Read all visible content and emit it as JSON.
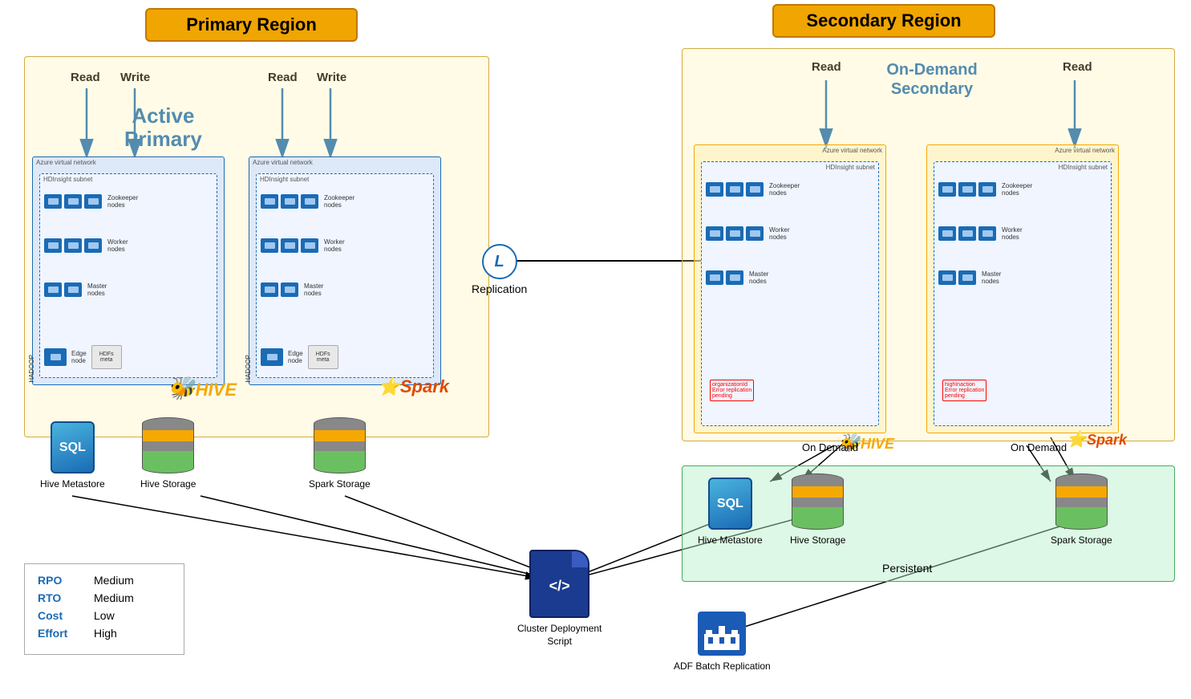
{
  "primaryRegion": {
    "label": "Primary Region",
    "activePrimary": "Active\nPrimary",
    "activePrimaryLine1": "Active",
    "activePrimaryLine2": "Primary"
  },
  "secondaryRegion": {
    "label": "Secondary Region",
    "onDemandLine1": "On-Demand",
    "onDemandLine2": "Secondary"
  },
  "labels": {
    "read1": "Read",
    "write1": "Write",
    "read2": "Read",
    "write2": "Write",
    "read3": "Read",
    "read4": "Read",
    "replication": "Replication",
    "replicationIcon": "L",
    "hiveMetastore": "Hive Metastore",
    "hiveStorage": "Hive Storage",
    "sparkStorage": "Spark Storage",
    "hiveMetastore2": "Hive Metastore",
    "hiveStorage2": "Hive Storage",
    "sparkStorage2": "Spark Storage",
    "onDemand1": "On Demand",
    "onDemand2": "On Demand",
    "persistent": "Persistent",
    "clusterDeployScript": "Cluster Deployment\nScript",
    "clusterDeployLine1": "Cluster Deployment",
    "clusterDeployLine2": "Script",
    "adfBatchReplication": "ADF Batch Replication",
    "scriptSymbol": "</>",
    "azureVnet1": "Azure virtual network",
    "azureVnet2": "Azure virtual network",
    "hdinsightSubnet1": "HDInsight subnet",
    "hdinsightSubnet2": "HDInsight subnet",
    "zookeeperNodes1": "Zookeeper\nnodes",
    "workerNodes1": "Worker\nnodes",
    "masterNodes1": "Master\nnodes",
    "zookeeperNodes2": "Zookeeper\nnodes",
    "workerNodes2": "Worker\nnodes",
    "masterNodes2": "Master\nnodes",
    "edgeNode1": "Edge\nnode",
    "edgeNode2": "Edge\nnode",
    "hdfsMetagen": "HDFs\nmeta gen",
    "hive": "HIVE",
    "spark": "Spark"
  },
  "legend": {
    "rpo": {
      "key": "RPO",
      "value": "Medium"
    },
    "rto": {
      "key": "RTO",
      "value": "Medium"
    },
    "cost": {
      "key": "Cost",
      "value": "Low"
    },
    "effort": {
      "key": "Effort",
      "value": "High"
    }
  }
}
